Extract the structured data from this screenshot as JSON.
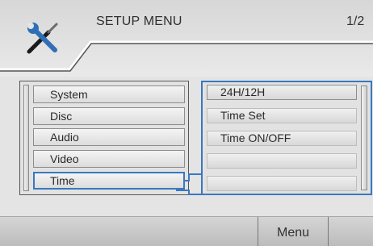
{
  "header": {
    "title": "SETUP MENU",
    "page_indicator": "1/2",
    "icon": "tools-icon"
  },
  "categories": [
    {
      "label": "System",
      "selected": false
    },
    {
      "label": "Disc",
      "selected": false
    },
    {
      "label": "Audio",
      "selected": false
    },
    {
      "label": "Video",
      "selected": false
    },
    {
      "label": "Time",
      "selected": true
    }
  ],
  "options": [
    {
      "label": "24H/12H"
    },
    {
      "label": "Time Set"
    },
    {
      "label": "Time ON/OFF"
    },
    {
      "label": ""
    },
    {
      "label": ""
    }
  ],
  "footer": {
    "menu_label": "Menu"
  },
  "colors": {
    "selection": "#3a78c0",
    "background": "#e4e4e4"
  }
}
